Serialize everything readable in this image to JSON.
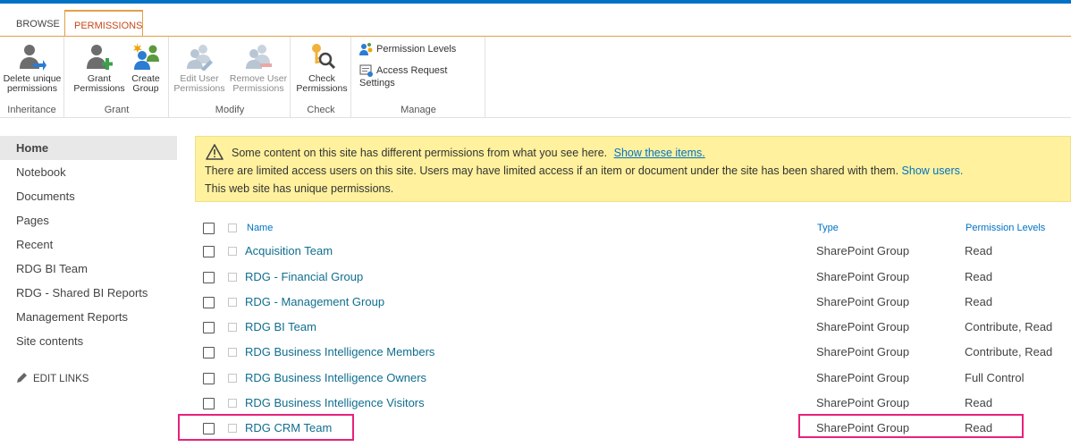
{
  "ribbon": {
    "tabs": [
      {
        "label": "BROWSE"
      },
      {
        "label": "PERMISSIONS"
      }
    ],
    "groups": {
      "inheritance": {
        "label": "Inheritance",
        "delete_unique_line1": "Delete unique",
        "delete_unique_line2": "permissions"
      },
      "grant": {
        "label": "Grant",
        "grant_line1": "Grant",
        "grant_line2": "Permissions",
        "create_line1": "Create",
        "create_line2": "Group"
      },
      "modify": {
        "label": "Modify",
        "edit_line1": "Edit User",
        "edit_line2": "Permissions",
        "remove_line1": "Remove User",
        "remove_line2": "Permissions"
      },
      "check": {
        "label": "Check",
        "check_line1": "Check",
        "check_line2": "Permissions"
      },
      "manage": {
        "label": "Manage",
        "permission_levels": "Permission Levels",
        "access_request_settings": "Access Request Settings"
      }
    }
  },
  "leftnav": {
    "items": [
      {
        "label": "Home",
        "selected": true
      },
      {
        "label": "Notebook"
      },
      {
        "label": "Documents"
      },
      {
        "label": "Pages"
      },
      {
        "label": "Recent"
      },
      {
        "label": "RDG BI Team"
      },
      {
        "label": "RDG - Shared BI Reports"
      },
      {
        "label": "Management Reports"
      },
      {
        "label": "Site contents"
      }
    ],
    "edit_links": "EDIT LINKS"
  },
  "banner": {
    "line1_text": "Some content on this site has different permissions from what you see here.",
    "line1_link": "Show these items.",
    "line2_text": "There are limited access users on this site. Users may have limited access if an item or document under the site has been shared with them.",
    "line2_link": "Show users.",
    "line3_text": "This web site has unique permissions."
  },
  "table": {
    "columns": {
      "name": "Name",
      "type": "Type",
      "permission_levels": "Permission Levels"
    },
    "rows": [
      {
        "name": "Acquisition Team",
        "type": "SharePoint Group",
        "permission": "Read"
      },
      {
        "name": "RDG - Financial Group",
        "type": "SharePoint Group",
        "permission": "Read"
      },
      {
        "name": "RDG - Management Group",
        "type": "SharePoint Group",
        "permission": "Read"
      },
      {
        "name": "RDG BI Team",
        "type": "SharePoint Group",
        "permission": "Contribute, Read"
      },
      {
        "name": "RDG Business Intelligence Members",
        "type": "SharePoint Group",
        "permission": "Contribute, Read"
      },
      {
        "name": "RDG Business Intelligence Owners",
        "type": "SharePoint Group",
        "permission": "Full Control"
      },
      {
        "name": "RDG Business Intelligence Visitors",
        "type": "SharePoint Group",
        "permission": "Read"
      },
      {
        "name": "RDG CRM Team",
        "type": "SharePoint Group",
        "permission": "Read"
      }
    ]
  },
  "colors": {
    "accent": "#0072c6",
    "tab_active": "#c8481a",
    "ribbon_line": "#e0a14a",
    "banner_bg": "#fff19d",
    "highlight": "#e8217b",
    "link": "#0f6e8f"
  }
}
